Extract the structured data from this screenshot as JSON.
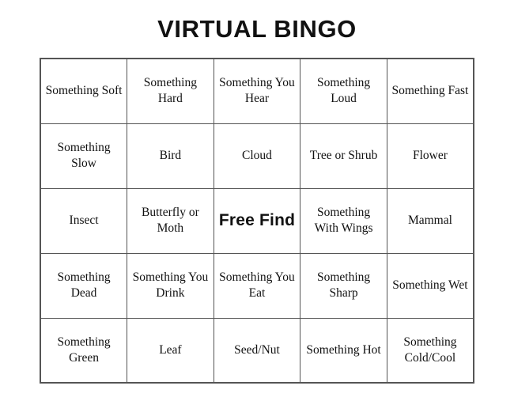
{
  "title": "VIRTUAL BINGO",
  "colors": {
    "background": "#ffffff",
    "text": "#111111",
    "grid_line": "#555555"
  },
  "grid": {
    "rows": 5,
    "columns": 5,
    "free_space_index": {
      "row": 2,
      "col": 2
    },
    "cells": [
      [
        {
          "label": "Something Soft",
          "free": false
        },
        {
          "label": "Something Hard",
          "free": false
        },
        {
          "label": "Something You Hear",
          "free": false
        },
        {
          "label": "Something Loud",
          "free": false
        },
        {
          "label": "Something Fast",
          "free": false
        }
      ],
      [
        {
          "label": "Something Slow",
          "free": false
        },
        {
          "label": "Bird",
          "free": false
        },
        {
          "label": "Cloud",
          "free": false
        },
        {
          "label": "Tree or Shrub",
          "free": false
        },
        {
          "label": "Flower",
          "free": false
        }
      ],
      [
        {
          "label": "Insect",
          "free": false
        },
        {
          "label": "Butterfly or Moth",
          "free": false
        },
        {
          "label": "Free Find",
          "free": true
        },
        {
          "label": "Something With Wings",
          "free": false
        },
        {
          "label": "Mammal",
          "free": false
        }
      ],
      [
        {
          "label": "Something Dead",
          "free": false
        },
        {
          "label": "Something You Drink",
          "free": false
        },
        {
          "label": "Something You Eat",
          "free": false
        },
        {
          "label": "Something Sharp",
          "free": false
        },
        {
          "label": "Something Wet",
          "free": false
        }
      ],
      [
        {
          "label": "Something Green",
          "free": false
        },
        {
          "label": "Leaf",
          "free": false
        },
        {
          "label": "Seed/Nut",
          "free": false
        },
        {
          "label": "Something Hot",
          "free": false
        },
        {
          "label": "Something Cold/Cool",
          "free": false
        }
      ]
    ]
  }
}
